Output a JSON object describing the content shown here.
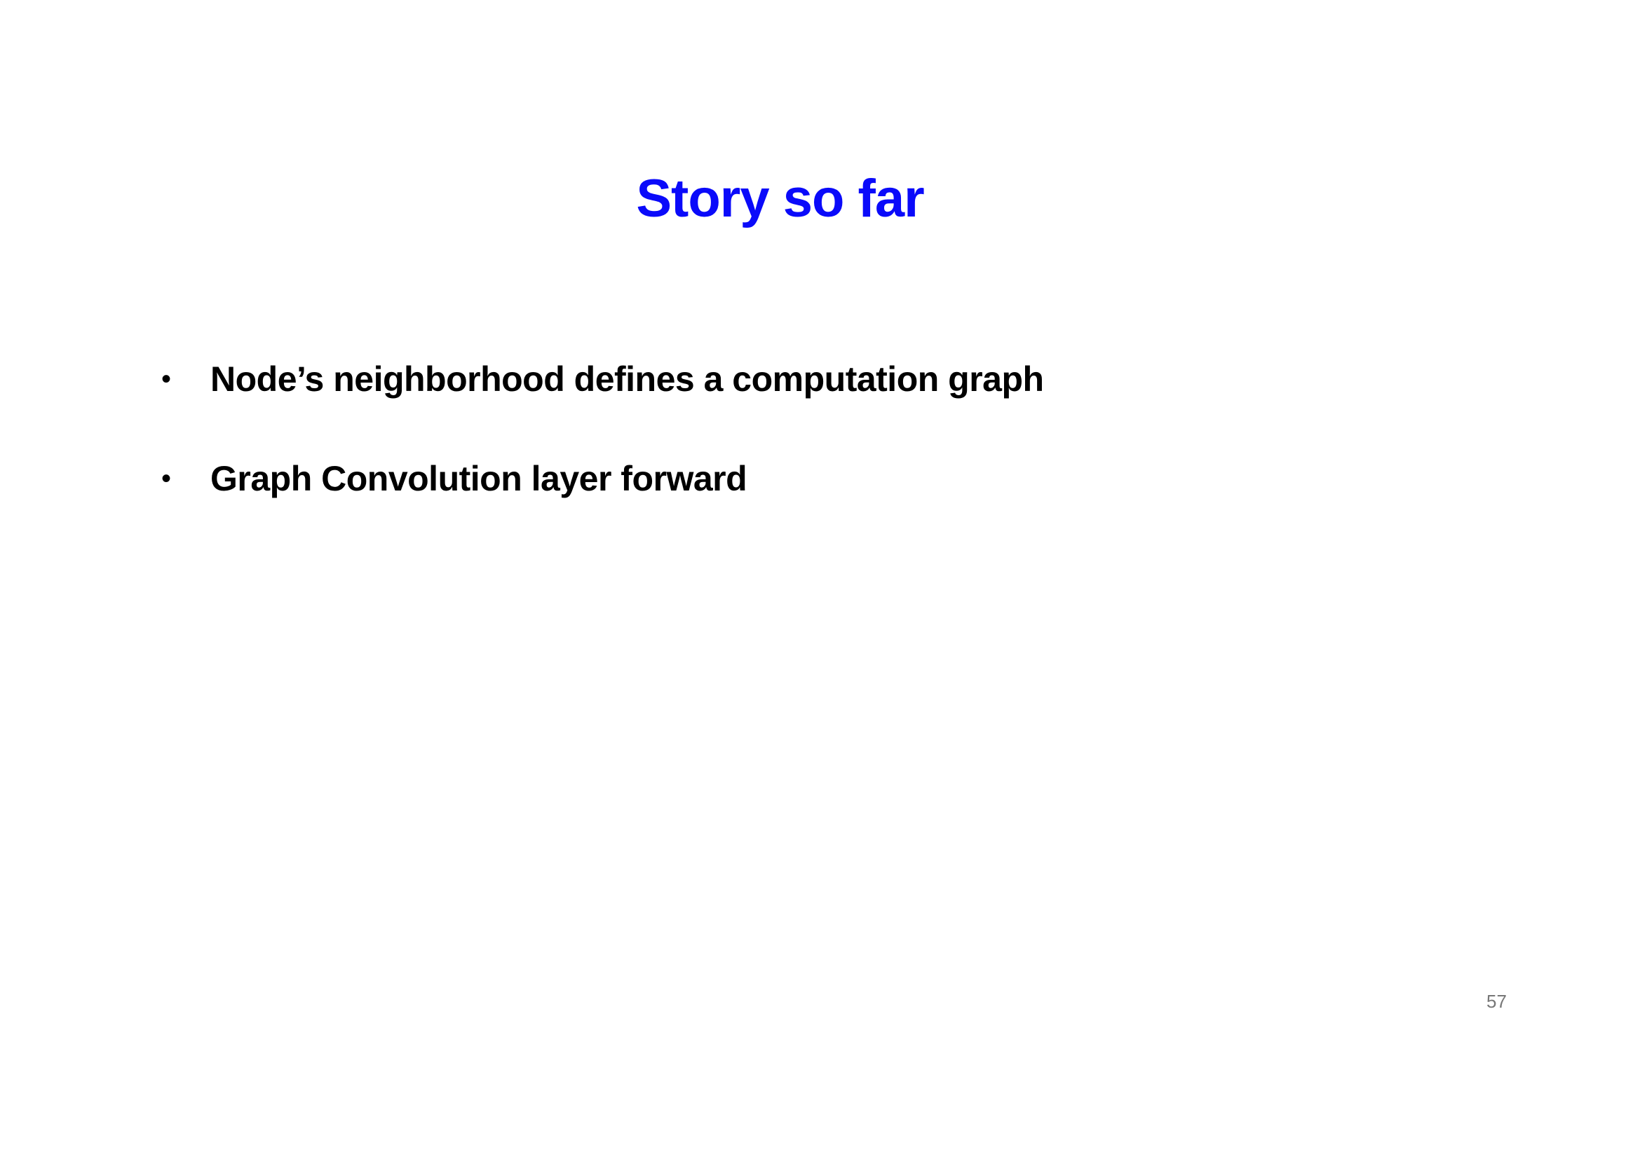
{
  "slide": {
    "title": "Story so far",
    "bullets": [
      {
        "marker": "•",
        "text": "Node’s neighborhood defines a computation graph"
      },
      {
        "marker": "•",
        "text": "Graph Convolution layer forward"
      }
    ],
    "page_number": "57"
  },
  "colors": {
    "title": "#0a0afa",
    "body_text": "#000000",
    "page_number": "#777777",
    "background": "#ffffff"
  }
}
